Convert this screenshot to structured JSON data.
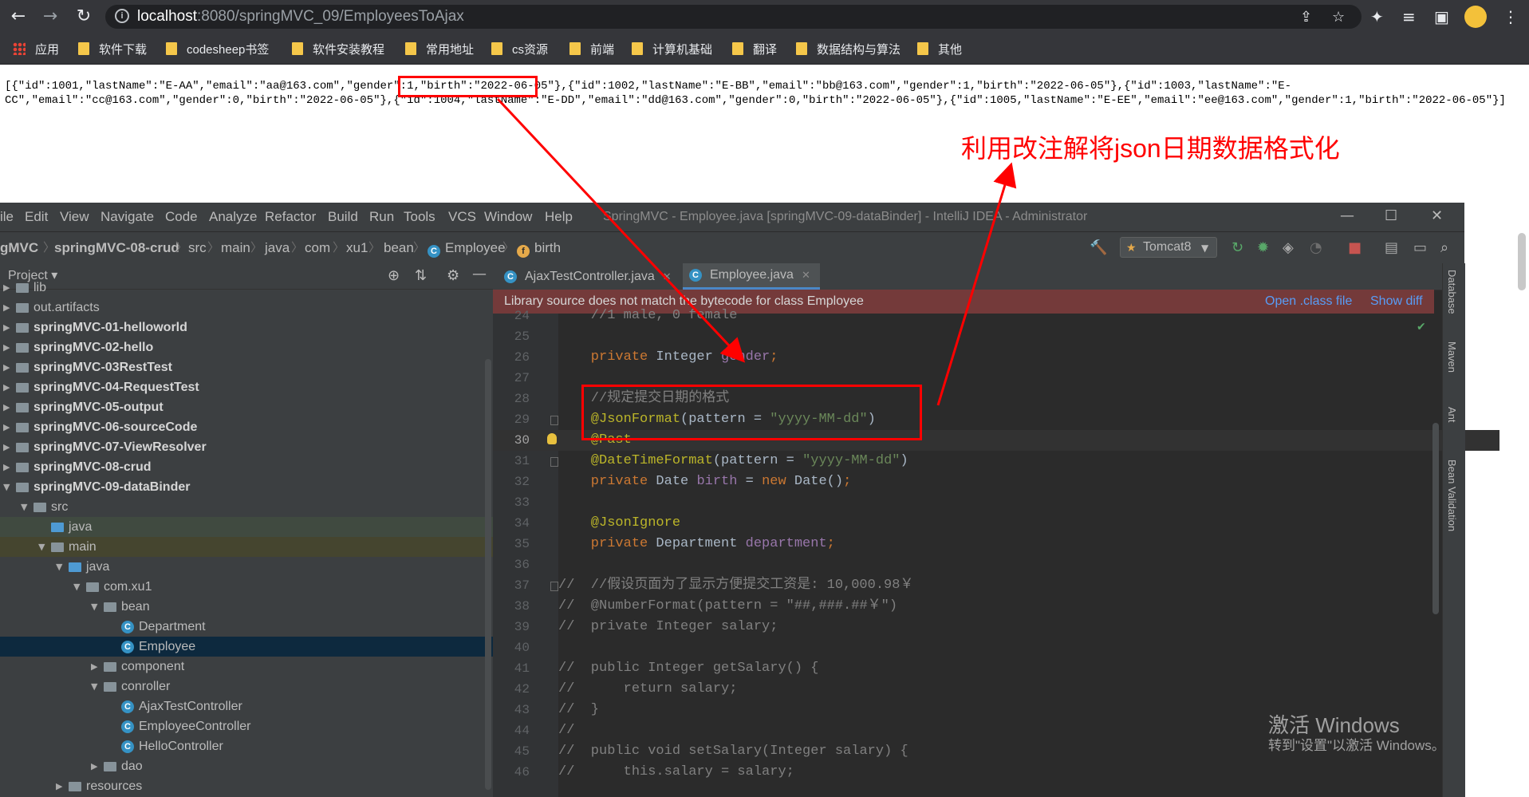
{
  "browser": {
    "url_host": "localhost",
    "url_path": ":8080/springMVC_09/EmployeesToAjax",
    "bookmarks": [
      "应用",
      "软件下载",
      "codesheep书签",
      "软件安装教程",
      "常用地址",
      "cs资源",
      "前端",
      "计算机基础",
      "翻译",
      "数据结构与算法",
      "其他"
    ]
  },
  "page": {
    "json_line1": "[{\"id\":1001,\"lastName\":\"E-AA\",\"email\":\"aa@163.com\",\"gender\":1,\"birth\":\"2022-06-05\"},{\"id\":1002,\"lastName\":\"E-BB\",\"email\":\"bb@163.com\",\"gender\":1,\"birth\":\"2022-06-05\"},{\"id\":1003,\"lastName\":\"E-",
    "json_line2": "CC\",\"email\":\"cc@163.com\",\"gender\":0,\"birth\":\"2022-06-05\"},{\"id\":1004,\"lastName\":\"E-DD\",\"email\":\"dd@163.com\",\"gender\":0,\"birth\":\"2022-06-05\"},{\"id\":1005,\"lastName\":\"E-EE\",\"email\":\"ee@163.com\",\"gender\":1,\"birth\":\"2022-06-05\"}]",
    "annotation": "利用改注解将json日期数据格式化"
  },
  "ide": {
    "menu": [
      "ile",
      "Edit",
      "View",
      "Navigate",
      "Code",
      "Analyze",
      "Refactor",
      "Build",
      "Run",
      "Tools",
      "VCS",
      "Window",
      "Help"
    ],
    "window_title": "SpringMVC - Employee.java [springMVC-09-dataBinder] - IntelliJ IDEA - Administrator",
    "breadcrumbs": [
      "gMVC",
      "springMVC-08-crud",
      "src",
      "main",
      "java",
      "com",
      "xu1",
      "bean",
      "Employee",
      "birth"
    ],
    "run_config": "Tomcat8",
    "project_label": "Project",
    "tree": [
      {
        "label": "lib",
        "depth": 0,
        "arrow": "▶",
        "bold": false,
        "kind": "folder",
        "state": ""
      },
      {
        "label": "out.artifacts",
        "depth": 0,
        "arrow": "▶",
        "bold": false,
        "kind": "folder",
        "state": ""
      },
      {
        "label": "springMVC-01-helloworld",
        "depth": 0,
        "arrow": "▶",
        "bold": true,
        "kind": "folder",
        "state": ""
      },
      {
        "label": "springMVC-02-hello",
        "depth": 0,
        "arrow": "▶",
        "bold": true,
        "kind": "folder",
        "state": ""
      },
      {
        "label": "springMVC-03RestTest",
        "depth": 0,
        "arrow": "▶",
        "bold": true,
        "kind": "folder",
        "state": ""
      },
      {
        "label": "springMVC-04-RequestTest",
        "depth": 0,
        "arrow": "▶",
        "bold": true,
        "kind": "folder",
        "state": ""
      },
      {
        "label": "springMVC-05-output",
        "depth": 0,
        "arrow": "▶",
        "bold": true,
        "kind": "folder",
        "state": ""
      },
      {
        "label": "springMVC-06-sourceCode",
        "depth": 0,
        "arrow": "▶",
        "bold": true,
        "kind": "folder",
        "state": ""
      },
      {
        "label": "springMVC-07-ViewResolver",
        "depth": 0,
        "arrow": "▶",
        "bold": true,
        "kind": "folder",
        "state": ""
      },
      {
        "label": "springMVC-08-crud",
        "depth": 0,
        "arrow": "▶",
        "bold": true,
        "kind": "folder",
        "state": ""
      },
      {
        "label": "springMVC-09-dataBinder",
        "depth": 0,
        "arrow": "▼",
        "bold": true,
        "kind": "folder",
        "state": ""
      },
      {
        "label": "src",
        "depth": 1,
        "arrow": "▼",
        "bold": false,
        "kind": "folder",
        "state": ""
      },
      {
        "label": "java",
        "depth": 2,
        "arrow": "",
        "bold": false,
        "kind": "folder-blue",
        "state": "hl"
      },
      {
        "label": "main",
        "depth": 2,
        "arrow": "▼",
        "bold": false,
        "kind": "folder",
        "state": "mod"
      },
      {
        "label": "java",
        "depth": 3,
        "arrow": "▼",
        "bold": false,
        "kind": "folder-blue",
        "state": ""
      },
      {
        "label": "com.xu1",
        "depth": 4,
        "arrow": "▼",
        "bold": false,
        "kind": "folder",
        "state": ""
      },
      {
        "label": "bean",
        "depth": 5,
        "arrow": "▼",
        "bold": false,
        "kind": "folder",
        "state": ""
      },
      {
        "label": "Department",
        "depth": 6,
        "arrow": "",
        "bold": false,
        "kind": "class",
        "state": ""
      },
      {
        "label": "Employee",
        "depth": 6,
        "arrow": "",
        "bold": false,
        "kind": "class",
        "state": "sel"
      },
      {
        "label": "component",
        "depth": 5,
        "arrow": "▶",
        "bold": false,
        "kind": "folder",
        "state": ""
      },
      {
        "label": "conroller",
        "depth": 5,
        "arrow": "▼",
        "bold": false,
        "kind": "folder",
        "state": ""
      },
      {
        "label": "AjaxTestController",
        "depth": 6,
        "arrow": "",
        "bold": false,
        "kind": "class",
        "state": ""
      },
      {
        "label": "EmployeeController",
        "depth": 6,
        "arrow": "",
        "bold": false,
        "kind": "class",
        "state": ""
      },
      {
        "label": "HelloController",
        "depth": 6,
        "arrow": "",
        "bold": false,
        "kind": "class",
        "state": ""
      },
      {
        "label": "dao",
        "depth": 5,
        "arrow": "▶",
        "bold": false,
        "kind": "folder",
        "state": ""
      },
      {
        "label": "resources",
        "depth": 3,
        "arrow": "▶",
        "bold": false,
        "kind": "folder",
        "state": ""
      }
    ],
    "tabs": [
      "AjaxTestController.java",
      "Employee.java"
    ],
    "active_tab": 1,
    "warning": {
      "text": "Library source does not match the bytecode for class Employee",
      "open_class": "Open .class file",
      "show_diff": "Show diff"
    },
    "current_line": 30,
    "code_lines": [
      {
        "n": "24",
        "tokens": [
          [
            "cm",
            "    //1 male, 0 female"
          ]
        ]
      },
      {
        "n": "25",
        "tokens": []
      },
      {
        "n": "26",
        "tokens": [
          [
            "kw",
            "    private "
          ],
          [
            "",
            "Integer "
          ],
          [
            "fd",
            "gender"
          ],
          [
            "kw",
            ";"
          ]
        ]
      },
      {
        "n": "27",
        "tokens": []
      },
      {
        "n": "28",
        "tokens": [
          [
            "cm",
            "    //规定提交日期的格式"
          ]
        ]
      },
      {
        "n": "29",
        "tokens": [
          [
            "an",
            "    @JsonFormat"
          ],
          [
            "",
            "(pattern = "
          ],
          [
            "st",
            "\"yyyy-MM-dd\""
          ],
          [
            "",
            ")"
          ]
        ]
      },
      {
        "n": "30",
        "tokens": [
          [
            "an",
            "    @Past"
          ]
        ]
      },
      {
        "n": "31",
        "tokens": [
          [
            "an",
            "    @DateTimeFormat"
          ],
          [
            "",
            "(pattern = "
          ],
          [
            "st",
            "\"yyyy-MM-dd\""
          ],
          [
            "",
            ")"
          ]
        ]
      },
      {
        "n": "32",
        "tokens": [
          [
            "kw",
            "    private "
          ],
          [
            "",
            "Date "
          ],
          [
            "fd",
            "birth"
          ],
          [
            "",
            " = "
          ],
          [
            "kw",
            "new "
          ],
          [
            "",
            "Date()"
          ],
          [
            "kw",
            ";"
          ]
        ]
      },
      {
        "n": "33",
        "tokens": []
      },
      {
        "n": "34",
        "tokens": [
          [
            "an",
            "    @JsonIgnore"
          ]
        ]
      },
      {
        "n": "35",
        "tokens": [
          [
            "kw",
            "    private "
          ],
          [
            "",
            "Department "
          ],
          [
            "fd",
            "department"
          ],
          [
            "kw",
            ";"
          ]
        ]
      },
      {
        "n": "36",
        "tokens": []
      },
      {
        "n": "37",
        "tokens": [
          [
            "cm",
            "//  //假设页面为了显示方便提交工资是: 10,000.98￥"
          ]
        ]
      },
      {
        "n": "38",
        "tokens": [
          [
            "cm",
            "//  @NumberFormat(pattern = \"##,###.##￥\")"
          ]
        ]
      },
      {
        "n": "39",
        "tokens": [
          [
            "cm",
            "//  private Integer salary;"
          ]
        ]
      },
      {
        "n": "40",
        "tokens": []
      },
      {
        "n": "41",
        "tokens": [
          [
            "cm",
            "//  public Integer getSalary() {"
          ]
        ]
      },
      {
        "n": "42",
        "tokens": [
          [
            "cm",
            "//      return salary;"
          ]
        ]
      },
      {
        "n": "43",
        "tokens": [
          [
            "cm",
            "//  }"
          ]
        ]
      },
      {
        "n": "44",
        "tokens": [
          [
            "cm",
            "//"
          ]
        ]
      },
      {
        "n": "45",
        "tokens": [
          [
            "cm",
            "//  public void setSalary(Integer salary) {"
          ]
        ]
      },
      {
        "n": "46",
        "tokens": [
          [
            "cm",
            "//      this.salary = salary;"
          ]
        ]
      }
    ],
    "side_tools": [
      "Database",
      "Maven",
      "Ant",
      "Bean Validation"
    ],
    "watermark_line1": "激活 Windows",
    "watermark_line2": "转到\"设置\"以激活 Windows。"
  }
}
